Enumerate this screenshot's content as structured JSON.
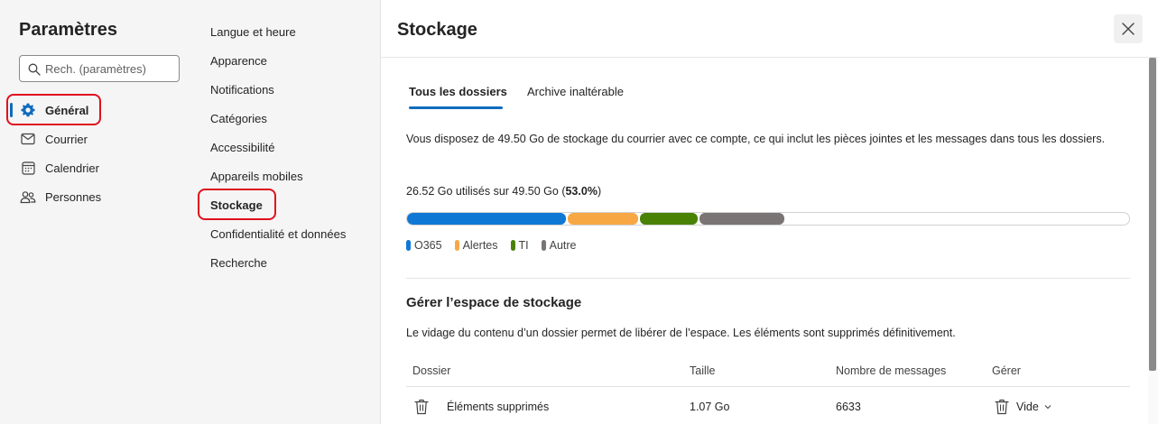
{
  "nav": {
    "title": "Paramètres",
    "search_placeholder": "Rech. (paramètres)",
    "items": [
      {
        "label": "Général",
        "icon": "gear-icon"
      },
      {
        "label": "Courrier",
        "icon": "mail-icon"
      },
      {
        "label": "Calendrier",
        "icon": "calendar-icon"
      },
      {
        "label": "Personnes",
        "icon": "people-icon"
      }
    ]
  },
  "subnav": {
    "items": [
      "Langue et heure",
      "Apparence",
      "Notifications",
      "Catégories",
      "Accessibilité",
      "Appareils mobiles",
      "Stockage",
      "Confidentialité et données",
      "Recherche"
    ],
    "active": "Stockage"
  },
  "main": {
    "title": "Stockage",
    "tabs": [
      "Tous les dossiers",
      "Archive inaltérable"
    ],
    "description": "Vous disposez de 49.50 Go de stockage du courrier avec ce compte, ce qui inclut les pièces jointes et les messages dans tous les dossiers.",
    "usage_text": "26.52 Go utilisés sur 49.50 Go (",
    "usage_percent": "53.0%",
    "usage_close": ")",
    "storage_bar": [
      {
        "name": "O365",
        "color": "#0f78d4",
        "fraction": 0.222
      },
      {
        "name": "Alertes",
        "color": "#f7a845",
        "fraction": 0.1
      },
      {
        "name": "TI",
        "color": "#498205",
        "fraction": 0.082
      },
      {
        "name": "Autre",
        "color": "#7a7574",
        "fraction": 0.12
      }
    ],
    "manage_title": "Gérer l’espace de stockage",
    "manage_description": "Le vidage du contenu d’un dossier permet de libérer de l’espace. Les éléments sont supprimés définitivement.",
    "table": {
      "headers": [
        "Dossier",
        "Taille",
        "Nombre de messages",
        "Gérer"
      ],
      "rows": [
        {
          "folder": "Éléments supprimés",
          "size": "1.07 Go",
          "count": "6633",
          "action": "Vide"
        }
      ]
    }
  }
}
